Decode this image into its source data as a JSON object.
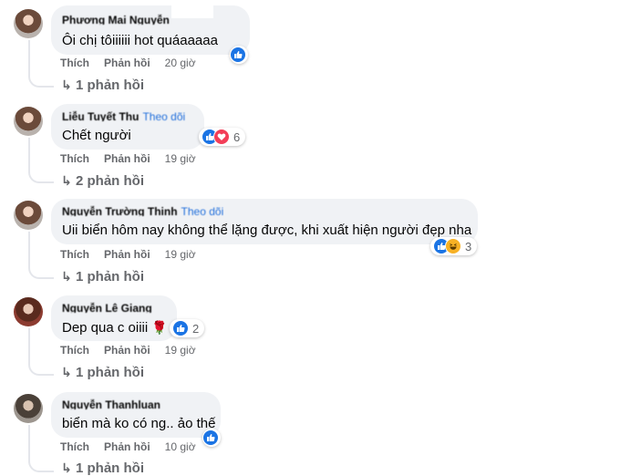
{
  "colors": {
    "like": "#1b74e4",
    "love": "#f33e58",
    "haha": "#f7b125",
    "meta_text": "#65676b",
    "bubble": "#f0f2f5",
    "link": "#216fdb"
  },
  "actions": {
    "like_label": "Thích",
    "reply_label": "Phản hồi"
  },
  "comments": [
    {
      "author": "Phương Mai Nguyễn",
      "text": "Ôi chị tôiiiiii hot quáaaaaa",
      "time": "20 giờ",
      "replies": "1 phản hồi",
      "reactions": [
        "like"
      ],
      "reaction_count": ""
    },
    {
      "author": "Liễu Tuyết Thu",
      "follow": "Theo dõi",
      "text": "Chết người",
      "time": "19 giờ",
      "replies": "2 phản hồi",
      "reactions": [
        "like",
        "love"
      ],
      "reaction_count": "6"
    },
    {
      "author": "Nguyễn Trường Thịnh",
      "follow": "Theo dõi",
      "text": "Uii biển hôm nay không thể lặng được, khi xuất hiện người đẹp nha",
      "time": "19 giờ",
      "replies": "1 phản hồi",
      "reactions": [
        "like",
        "haha"
      ],
      "reaction_count": "3"
    },
    {
      "author": "Nguyễn Lê Giang",
      "text": "Dep qua c oiiii",
      "emoji": "🌹",
      "time": "19 giờ",
      "replies": "1 phản hồi",
      "reactions": [
        "like"
      ],
      "reaction_count": "2"
    },
    {
      "author": "Nguyễn Thanhluan",
      "text": "biển mà ko có ng.. ảo thế",
      "time": "10 giờ",
      "replies": "1 phản hồi",
      "reactions": [
        "like"
      ],
      "reaction_count": ""
    }
  ]
}
